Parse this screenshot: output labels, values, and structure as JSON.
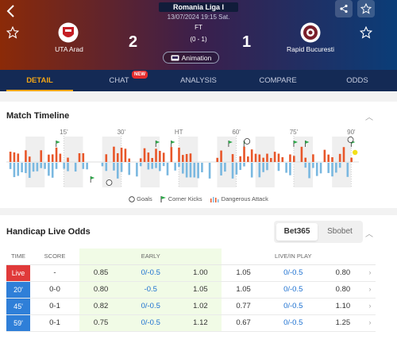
{
  "match": {
    "league": "Romania Liga I",
    "datetime": "13/07/2024 19:15 Sat.",
    "home": {
      "name": "UTA Arad",
      "score": "2"
    },
    "away": {
      "name": "Rapid Bucuresti",
      "score": "1"
    },
    "status": "FT",
    "half_time": "(0 - 1)",
    "animation_label": "Animation"
  },
  "tabs": [
    {
      "label": "DETAIL",
      "active": true
    },
    {
      "label": "CHAT",
      "badge": "NEW"
    },
    {
      "label": "ANALYSIS"
    },
    {
      "label": "COMPARE"
    },
    {
      "label": "ODDS"
    }
  ],
  "timeline": {
    "title": "Match Timeline",
    "markers": [
      "15'",
      "30'",
      "HT",
      "60'",
      "75'",
      "90'"
    ],
    "legend": {
      "goals": "Goals",
      "corners": "Corner Kicks",
      "attack": "Dangerous Attack"
    },
    "home_color": "#e8572a",
    "away_color": "#7ab8e0"
  },
  "odds": {
    "title": "Handicap Live Odds",
    "bookmakers": [
      "Bet365",
      "Sbobet"
    ],
    "columns": {
      "time": "TIME",
      "score": "SCORE",
      "early": "EARLY",
      "live": "LIVE/IN PLAY"
    },
    "rows": [
      {
        "time": "Live",
        "score": "-",
        "e1": "0.85",
        "e2": "0/-0.5",
        "e3": "1.00",
        "l1": "1.05",
        "l2": "0/-0.5",
        "l3": "0.80"
      },
      {
        "time": "20'",
        "score": "0-0",
        "e1": "0.80",
        "e2": "-0.5",
        "e3": "1.05",
        "l1": "1.05",
        "l2": "0/-0.5",
        "l3": "0.80"
      },
      {
        "time": "45'",
        "score": "0-1",
        "e1": "0.82",
        "e2": "0/-0.5",
        "e3": "1.02",
        "l1": "0.77",
        "l2": "0/-0.5",
        "l3": "1.10"
      },
      {
        "time": "59'",
        "score": "0-1",
        "e1": "0.75",
        "e2": "0/-0.5",
        "e3": "1.12",
        "l1": "0.67",
        "l2": "0/-0.5",
        "l3": "1.25"
      }
    ]
  }
}
